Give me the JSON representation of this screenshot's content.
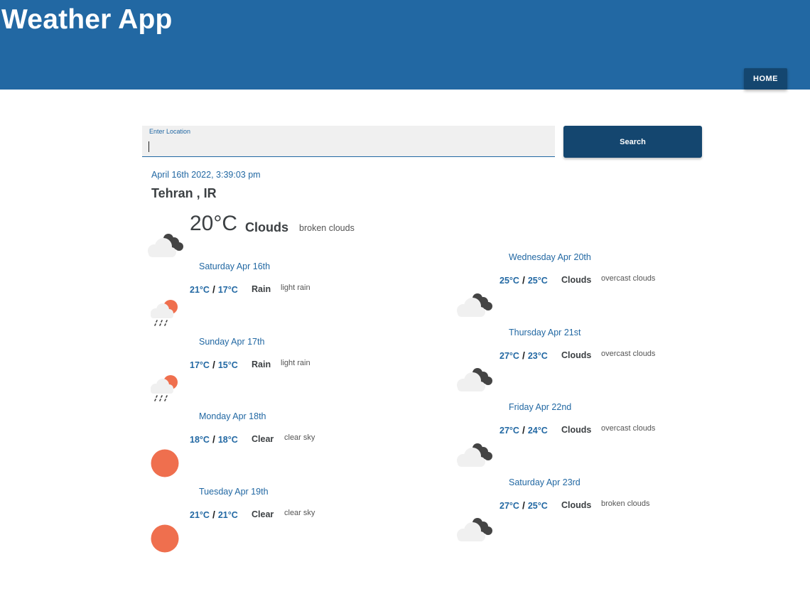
{
  "header": {
    "title": "Weather App",
    "home_label": "HOME"
  },
  "search": {
    "label": "Enter Location",
    "value": "",
    "button_label": "Search"
  },
  "current": {
    "datetime": "April 16th 2022, 3:39:03 pm",
    "location": "Tehran , IR",
    "temp": "20°C",
    "main": "Clouds",
    "description": "broken clouds",
    "icon": "broken-clouds-icon"
  },
  "forecast": [
    {
      "day": "Saturday Apr 16th",
      "max": "21°C",
      "min": "17°C",
      "main": "Rain",
      "description": "light rain",
      "icon": "light-rain-icon"
    },
    {
      "day": "Sunday Apr 17th",
      "max": "17°C",
      "min": "15°C",
      "main": "Rain",
      "description": "light rain",
      "icon": "light-rain-icon"
    },
    {
      "day": "Monday Apr 18th",
      "max": "18°C",
      "min": "18°C",
      "main": "Clear",
      "description": "clear sky",
      "icon": "clear-sky-icon"
    },
    {
      "day": "Tuesday Apr 19th",
      "max": "21°C",
      "min": "21°C",
      "main": "Clear",
      "description": "clear sky",
      "icon": "clear-sky-icon"
    },
    {
      "day": "Wednesday Apr 20th",
      "max": "25°C",
      "min": "25°C",
      "main": "Clouds",
      "description": "overcast clouds",
      "icon": "overcast-clouds-icon"
    },
    {
      "day": "Thursday Apr 21st",
      "max": "27°C",
      "min": "23°C",
      "main": "Clouds",
      "description": "overcast clouds",
      "icon": "overcast-clouds-icon"
    },
    {
      "day": "Friday Apr 22nd",
      "max": "27°C",
      "min": "24°C",
      "main": "Clouds",
      "description": "overcast clouds",
      "icon": "overcast-clouds-icon"
    },
    {
      "day": "Saturday Apr 23rd",
      "max": "27°C",
      "min": "25°C",
      "main": "Clouds",
      "description": "broken clouds",
      "icon": "broken-clouds-icon"
    }
  ],
  "colors": {
    "header": "#2268a3",
    "button": "#14466f",
    "accent": "#2268a3",
    "sun": "#ef6f4e",
    "cloud": "#f0f0f0",
    "dark_cloud": "#444444"
  }
}
